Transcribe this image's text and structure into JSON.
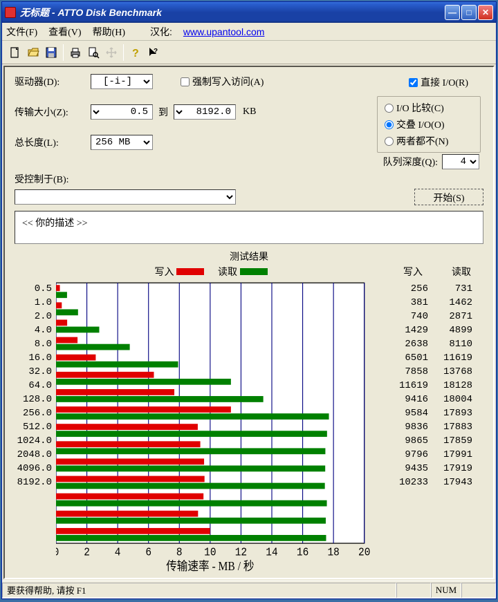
{
  "title": "无标题 - ATTO Disk Benchmark",
  "menus": {
    "file": "文件(F)",
    "view": "查看(V)",
    "help": "帮助(H)",
    "hanhua": "汉化:",
    "url": "www.upantool.com"
  },
  "labels": {
    "drive": "驱动器(D):",
    "transfer": "传输大小(Z):",
    "to": "到",
    "kb": "KB",
    "total_len": "总长度(L):",
    "force_write": "强制写入访问(A)",
    "direct_io": "直接 I/O(R)",
    "io_compare": "I/O 比较(C)",
    "overlap_io": "交叠 I/O(O)",
    "neither": "两者都不(N)",
    "queue_depth": "队列深度(Q):",
    "controlled": "受控制于(B):",
    "start": "开始(S)",
    "desc": "<<  你的描述   >>",
    "results_title": "测试结果",
    "write": "写入",
    "read": "读取",
    "xaxis": "传输速率 - MB / 秒"
  },
  "values": {
    "drive": "[-i-]",
    "transfer_from": "0.5",
    "transfer_to": "8192.0",
    "total_len": "256 MB",
    "force_write_checked": false,
    "direct_io_checked": true,
    "io_mode": "overlap",
    "queue_depth": "4",
    "controlled": ""
  },
  "chart_data": {
    "type": "bar",
    "xlabel": "传输速率 - MB / 秒",
    "xlim": [
      0,
      20
    ],
    "xticks": [
      0,
      2,
      4,
      6,
      8,
      10,
      12,
      14,
      16,
      18,
      20
    ],
    "unit_conv_kb_to_mb": 1024,
    "categories": [
      "0.5",
      "1.0",
      "2.0",
      "4.0",
      "8.0",
      "16.0",
      "32.0",
      "64.0",
      "128.0",
      "256.0",
      "512.0",
      "1024.0",
      "2048.0",
      "4096.0",
      "8192.0"
    ],
    "series": [
      {
        "name": "写入",
        "color": "#e00000",
        "values_kb": [
          256,
          381,
          740,
          1429,
          2638,
          6501,
          7858,
          11619,
          9416,
          9584,
          9836,
          9865,
          9796,
          9435,
          10233
        ]
      },
      {
        "name": "读取",
        "color": "#008000",
        "values_kb": [
          731,
          1462,
          2871,
          4899,
          8110,
          11619,
          13768,
          18128,
          18004,
          17893,
          17883,
          17859,
          17991,
          17919,
          17943
        ]
      }
    ]
  },
  "statusbar": {
    "help": "要获得帮助, 请按 F1",
    "num": "NUM"
  }
}
